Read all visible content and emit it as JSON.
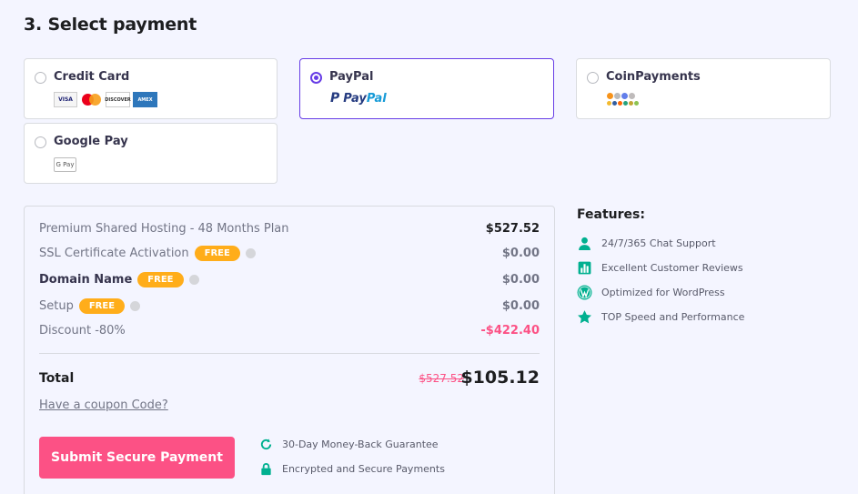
{
  "heading": "3. Select payment",
  "payment_methods": [
    {
      "label": "Credit Card",
      "selected": false,
      "logos": [
        "VISA",
        "mastercard",
        "DISCOVER",
        "AMERICAN EXPRESS"
      ]
    },
    {
      "label": "PayPal",
      "selected": true,
      "logo_text_1": "Pay",
      "logo_text_2": "Pal",
      "logo_mark": "P"
    },
    {
      "label": "CoinPayments",
      "selected": false
    },
    {
      "label": "Google Pay",
      "selected": false,
      "logo_text": "G Pay"
    }
  ],
  "summary": {
    "items": [
      {
        "label": "Premium Shared Hosting - 48 Months Plan",
        "value": "$527.52"
      },
      {
        "label": "SSL Certificate Activation",
        "badge": "FREE",
        "value": "$0.00"
      },
      {
        "label": "Domain Name",
        "badge": "FREE",
        "value": "$0.00"
      },
      {
        "label": "Setup",
        "badge": "FREE",
        "value": "$0.00"
      },
      {
        "label": "Discount -80%",
        "value": "-$422.40"
      }
    ],
    "total_label": "Total",
    "old_price": "$527.52",
    "new_price": "$105.12",
    "coupon_link": "Have a coupon Code?",
    "submit_label": "Submit Secure Payment",
    "guarantees": [
      "30-Day Money-Back Guarantee",
      "Encrypted and Secure Payments"
    ]
  },
  "features": {
    "title": "Features:",
    "items": [
      {
        "label": "24/7/365 Chat Support",
        "icon": "user-icon"
      },
      {
        "label": "Excellent Customer Reviews",
        "icon": "chart-icon"
      },
      {
        "label": "Optimized for WordPress",
        "icon": "wordpress-icon"
      },
      {
        "label": "TOP Speed and Performance",
        "icon": "star-icon"
      }
    ]
  },
  "colors": {
    "accent": "#673de6",
    "pink": "#fc5185",
    "badge": "#ffad1a",
    "green": "#00b090"
  }
}
